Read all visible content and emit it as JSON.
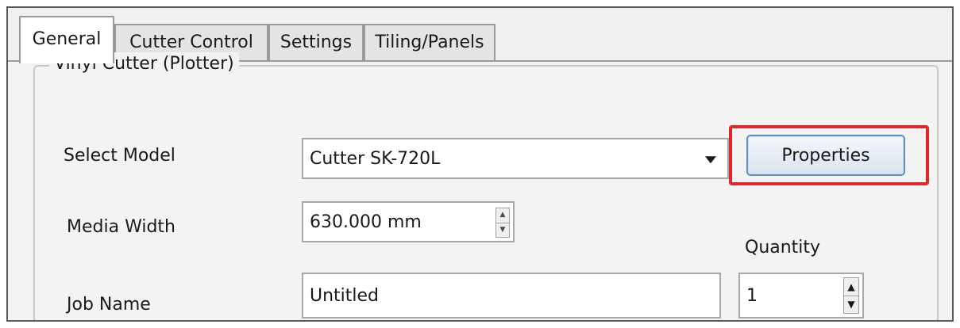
{
  "tabs": [
    {
      "label": "General",
      "active": true
    },
    {
      "label": "Cutter Control",
      "active": false
    },
    {
      "label": "Settings",
      "active": false
    },
    {
      "label": "Tiling/Panels",
      "active": false
    }
  ],
  "group": {
    "title": "Vinyl Cutter (Plotter)"
  },
  "fields": {
    "select_model_label": "Select Model",
    "select_model_value": "Cutter SK-720L",
    "properties_label": "Properties",
    "media_width_label": "Media Width",
    "media_width_value": "630.000 mm",
    "quantity_label": "Quantity",
    "quantity_value": "1",
    "job_name_label": "Job Name",
    "job_name_value": "Untitled"
  },
  "colors": {
    "highlight": "#e3252c",
    "button_border": "#5d8fc6"
  },
  "icons": {
    "dropdown": "chevron-down-icon",
    "spinner": "spinner-up-down-icon"
  }
}
